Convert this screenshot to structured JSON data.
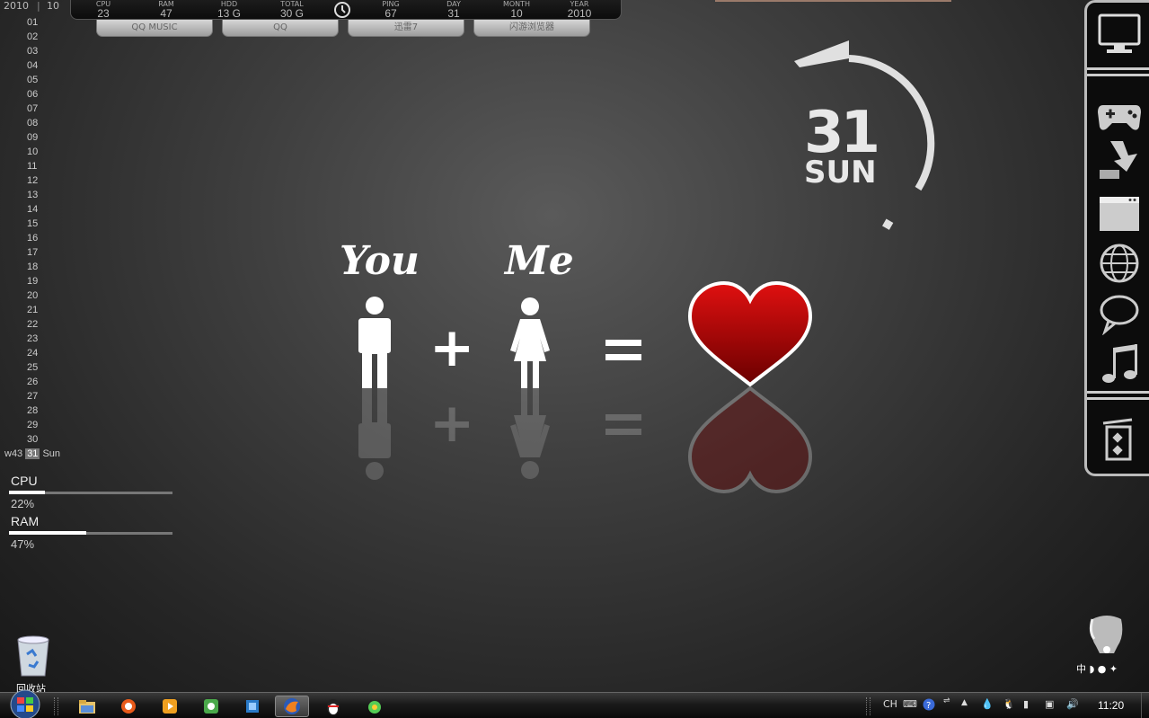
{
  "top_bar": {
    "year": "2010",
    "month_num": "10",
    "stats": [
      {
        "label": "CPU",
        "value": "23"
      },
      {
        "label": "RAM",
        "value": "47"
      },
      {
        "label": "HDD",
        "value": "13 G"
      },
      {
        "label": "TOTAL",
        "value": "30 G"
      },
      {
        "label": "PING",
        "value": "67"
      },
      {
        "label": "DAY",
        "value": "31"
      },
      {
        "label": "MONTH",
        "value": "10"
      },
      {
        "label": "YEAR",
        "value": "2010"
      }
    ],
    "quick_buttons": [
      "QQ MUSIC",
      "QQ",
      "迅雷7",
      "闪游浏览器"
    ]
  },
  "calendar": {
    "days": [
      "01",
      "02",
      "03",
      "04",
      "05",
      "06",
      "07",
      "08",
      "09",
      "10",
      "11",
      "12",
      "13",
      "14",
      "15",
      "16",
      "17",
      "18",
      "19",
      "20",
      "21",
      "22",
      "23",
      "24",
      "25",
      "26",
      "27",
      "28",
      "29",
      "30"
    ],
    "week": "w43",
    "today": "31",
    "weekday": "Sun"
  },
  "meters": {
    "cpu": {
      "label": "CPU",
      "percent_text": "22%",
      "value": 0.22
    },
    "ram": {
      "label": "RAM",
      "percent_text": "47%",
      "value": 0.47
    }
  },
  "clock_art": {
    "day": "31",
    "weekday": "SUN"
  },
  "art": {
    "you": "You",
    "me": "Me",
    "plus": "+",
    "equals": "="
  },
  "dock": {
    "icons": [
      "computer-icon",
      "gamepad-icon",
      "download-icon",
      "window-icon",
      "globe-icon",
      "chat-bubble-icon",
      "music-note-icon",
      "recycle-bin-icon"
    ]
  },
  "desktop": {
    "recycle_label": "回收站",
    "ime_text": "中"
  },
  "taskbar": {
    "apps": [
      "start-orb-icon",
      "explorer-icon",
      "browser-icon",
      "media-player-icon",
      "green-app-icon",
      "blue-app-icon",
      "firefox-icon",
      "qq-penguin-icon",
      "green-ball-icon"
    ],
    "tray_lang": "CH",
    "time": "11:20"
  }
}
